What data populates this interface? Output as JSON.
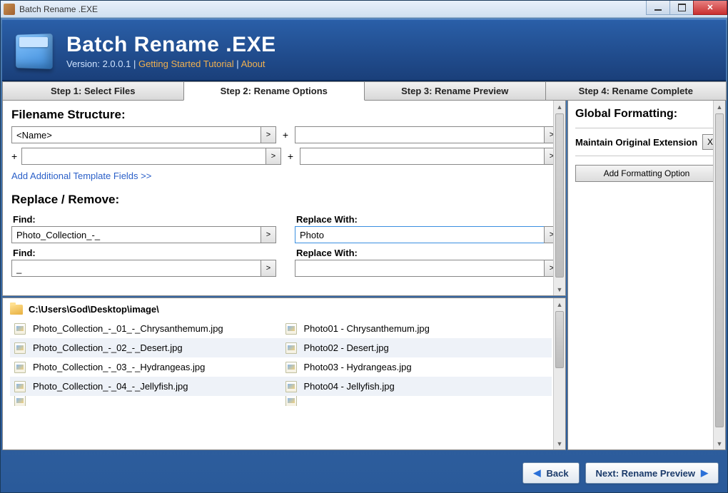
{
  "window": {
    "title": "Batch Rename .EXE"
  },
  "banner": {
    "title": "Batch Rename .EXE",
    "version_label": "Version: 2.0.0.1",
    "tutorial_link": "Getting Started Tutorial",
    "about_link": "About",
    "sep": " | "
  },
  "tabs": {
    "t1": "Step 1: Select Files",
    "t2": "Step 2: Rename Options",
    "t3": "Step 3: Rename Preview",
    "t4": "Step 4: Rename Complete"
  },
  "filename_structure": {
    "heading": "Filename Structure:",
    "field1": "<Name>",
    "field2": "",
    "field3": "",
    "field4": "",
    "add_link": "Add Additional Template Fields >>"
  },
  "replace_remove": {
    "heading": "Replace / Remove:",
    "find_label": "Find:",
    "replace_label": "Replace With:",
    "find1": "Photo_Collection_-_",
    "replace1": "Photo",
    "find2": "_",
    "replace2": ""
  },
  "filelist": {
    "path": "C:\\Users\\God\\Desktop\\image\\",
    "orig": [
      "Photo_Collection_-_01_-_Chrysanthemum.jpg",
      "Photo_Collection_-_02_-_Desert.jpg",
      "Photo_Collection_-_03_-_Hydrangeas.jpg",
      "Photo_Collection_-_04_-_Jellyfish.jpg"
    ],
    "renamed": [
      "Photo01 - Chrysanthemum.jpg",
      "Photo02 - Desert.jpg",
      "Photo03 - Hydrangeas.jpg",
      "Photo04 - Jellyfish.jpg"
    ]
  },
  "global_formatting": {
    "heading": "Global Formatting:",
    "maintain_ext": "Maintain Original Extension",
    "x": "X",
    "add_option": "Add Formatting Option"
  },
  "footer": {
    "back": "Back",
    "next": "Next: Rename Preview"
  },
  "glyphs": {
    "caret": ">",
    "plus": "+"
  }
}
